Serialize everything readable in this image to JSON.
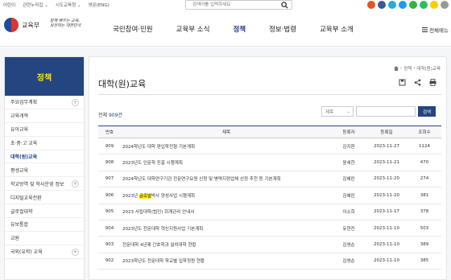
{
  "top_util": [
    "어린이",
    "관련누리집 ⌄",
    "시도교육청 ⌄",
    "영문(ENG)"
  ],
  "search": {
    "placeholder": "검색어를 입력하세요"
  },
  "sns_colors": [
    "#e8531e",
    "#3b5998",
    "#2ca7e0",
    "#1d9bf0",
    "#3bb143",
    "#2dbe60",
    "#ffcd00",
    "#999999"
  ],
  "logo": {
    "ministry": "교육부",
    "slogan": "함께 배우는 교육, 성장하는 대한민국"
  },
  "gnb": [
    "국민참여·민원",
    "교육부 소식",
    "정책",
    "정보·법령",
    "교육부 소개"
  ],
  "allmenu": "전체메뉴",
  "sidebar": {
    "title": "정책",
    "items": [
      {
        "label": "주요업무계획"
      },
      {
        "label": "교육개혁"
      },
      {
        "label": "유아교육"
      },
      {
        "label": "초·중·고 교육"
      },
      {
        "label": "대학(원)교육"
      },
      {
        "label": "평생교육"
      },
      {
        "label": "학교방역 및 학사운영 정보"
      },
      {
        "label": "디지털교육전환"
      },
      {
        "label": "글로컬대학"
      },
      {
        "label": "유보통합"
      },
      {
        "label": "교원"
      },
      {
        "label": "국외(유학) 교육"
      }
    ]
  },
  "page": {
    "title": "대학(원)교육",
    "breadcrumb": [
      "정책",
      "대학(원)교육"
    ],
    "total_prefix": "전체",
    "total_count": "909",
    "total_suffix": "건"
  },
  "searchbar": {
    "select": "제목",
    "button": "검색"
  },
  "table": {
    "headers": [
      "번호",
      "제목",
      "등록자",
      "등록일",
      "조회수"
    ],
    "rows": [
      {
        "no": "909",
        "title": "2024학년도 대학 편입학전형 기본계획",
        "author": "김지환",
        "date": "2023-11-27",
        "views": "1124"
      },
      {
        "no": "908",
        "title": "2023년도 인문학 진흥 시행계획",
        "author": "윤세한",
        "date": "2023-11-21",
        "views": "470"
      },
      {
        "no": "907",
        "title": "2024학년도 대학연구기관 전문연구요원 신청 및 병역지정업체 선정 추천 등 기본계획",
        "author": "김혜린",
        "date": "2023-11-20",
        "views": "274"
      },
      {
        "no": "906",
        "title_pre": "2023년 ",
        "title_hl": "글로벌",
        "title_post": "박사 양성사업 시행계획",
        "author": "김혜린",
        "date": "2023-11-20",
        "views": "381"
      },
      {
        "no": "905",
        "title": "2023 사립대학(법인) 회계관리 안내서",
        "author": "이소희",
        "date": "2023-11-17",
        "views": "378"
      },
      {
        "no": "904",
        "title": "2023년도 전문대학 혁신지원사업 기본계획",
        "author": "유현진",
        "date": "2023-11-10",
        "views": "503"
      },
      {
        "no": "903",
        "title": "전문대학 4년제 간호학과 설치대학 현황",
        "author": "김영순",
        "date": "2023-11-10",
        "views": "389"
      },
      {
        "no": "902",
        "title": "2023학년도 전문대학 학교별 입학정원 현황",
        "author": "김영순",
        "date": "2023-11-10",
        "views": "385"
      }
    ]
  }
}
